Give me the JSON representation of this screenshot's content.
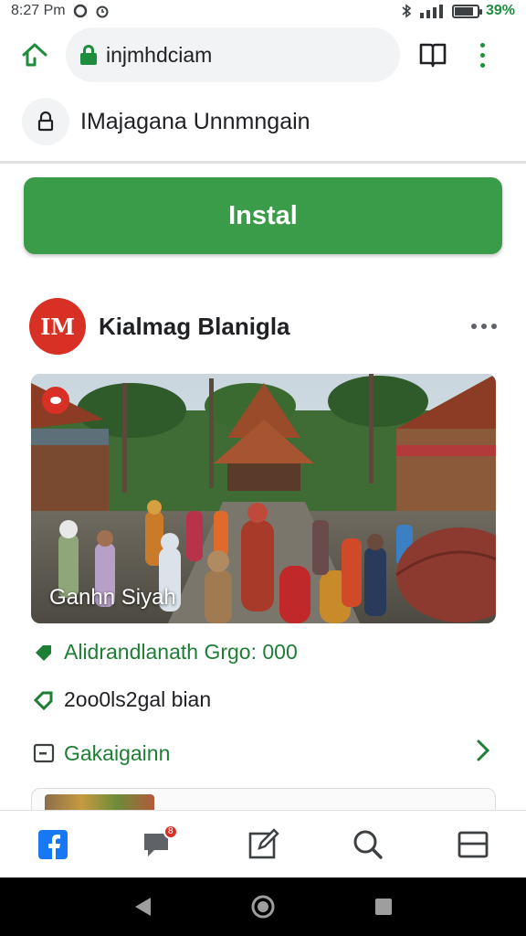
{
  "status_bar": {
    "time": "8:27 Pm",
    "battery_text": "39%",
    "battery_level": 0.85
  },
  "browser": {
    "url": "injmhdciam",
    "icons": [
      "home-icon",
      "lock-icon",
      "reader-icon",
      "more-vert-icon"
    ]
  },
  "site": {
    "name": "IMajagana Unnmngain"
  },
  "install": {
    "label": "Instal"
  },
  "post": {
    "avatar_text": "IM",
    "title": "Kialmag Blanigla",
    "photo_caption": "Ganhn Siyah"
  },
  "details": [
    {
      "icon": "tag-icon",
      "text": "Alidrandlanath Grgo: 000"
    },
    {
      "icon": "label-outline-icon",
      "text": "2oo0ls2gal bian"
    },
    {
      "icon": "card-icon",
      "text": "Gakaigainn"
    }
  ],
  "bottom_nav": {
    "notification_count": "8",
    "items": [
      "facebook-icon",
      "chat-icon",
      "edit-icon",
      "search-icon",
      "tabs-icon"
    ]
  },
  "colors": {
    "accent_green": "#3a9b48",
    "text_green": "#1e7e34",
    "brand_red": "#d93025",
    "facebook_blue": "#1877f2"
  }
}
